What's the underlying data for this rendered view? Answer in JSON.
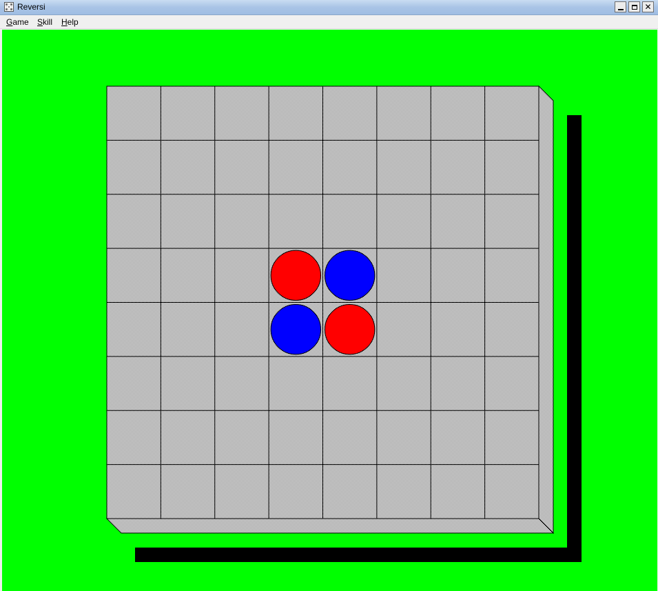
{
  "window": {
    "title": "Reversi",
    "minimize_label": "",
    "close_glyph": "✕"
  },
  "menu": [
    {
      "label": "Game"
    },
    {
      "label": "Skill"
    },
    {
      "label": "Help"
    }
  ],
  "colors": {
    "background": "#00ff00",
    "board_face": "#d8d8d8",
    "grid_line": "#000000",
    "shadow": "#000000",
    "player_red": "#ff0000",
    "player_blue": "#0000ff"
  },
  "board": {
    "rows": 8,
    "cols": 8,
    "pieces": [
      {
        "row": 3,
        "col": 3,
        "color": "red"
      },
      {
        "row": 3,
        "col": 4,
        "color": "blue"
      },
      {
        "row": 4,
        "col": 3,
        "color": "blue"
      },
      {
        "row": 4,
        "col": 4,
        "color": "red"
      }
    ]
  }
}
